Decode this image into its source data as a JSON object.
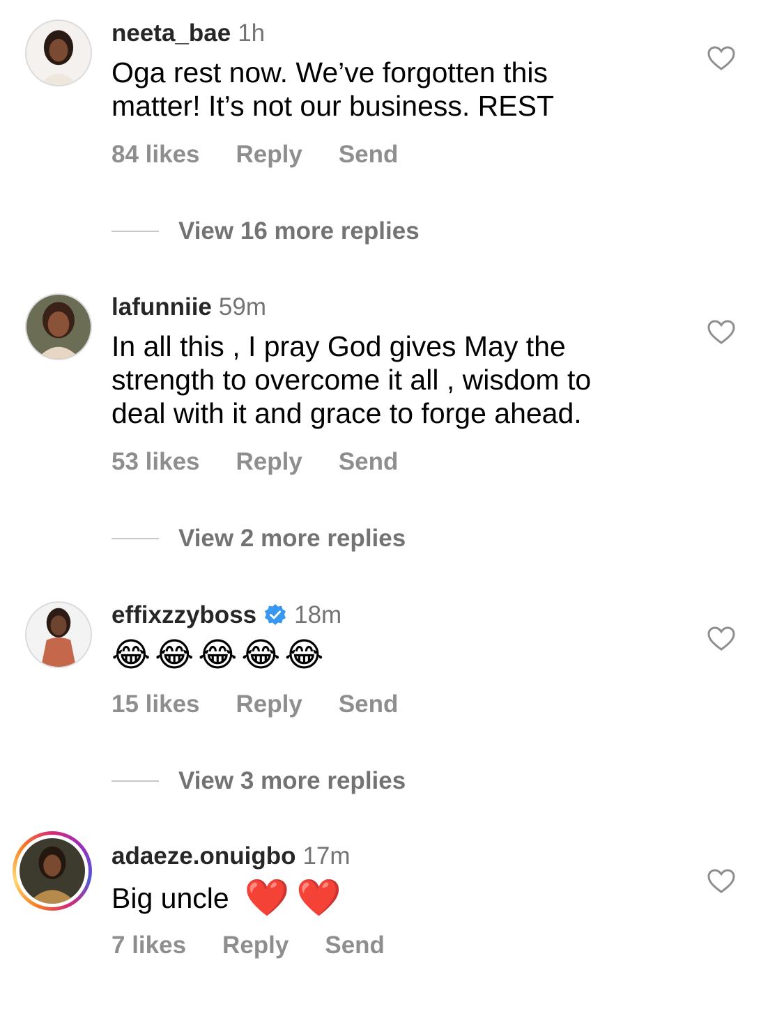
{
  "comments": [
    {
      "username": "neeta_bae",
      "time": "1h",
      "text_lines": [
        "Oga rest now. We’ve forgotten this",
        "matter! It’s not our business. REST"
      ],
      "likes": "84 likes",
      "reply": "Reply",
      "send": "Send",
      "view_replies": "View 16 more replies"
    },
    {
      "username": "lafunniie",
      "time": "59m",
      "text_lines": [
        "In all this , I pray God gives May the",
        "strength to overcome it all , wisdom to",
        "deal with it  and grace to forge ahead."
      ],
      "likes": "53 likes",
      "reply": "Reply",
      "send": "Send",
      "view_replies": "View 2 more replies"
    },
    {
      "username": "effixzzyboss",
      "time": "18m",
      "verified": true,
      "emojis": [
        "😂",
        "😂",
        "😂",
        "😂",
        "😂"
      ],
      "likes": "15 likes",
      "reply": "Reply",
      "send": "Send",
      "view_replies": "View 3 more replies"
    },
    {
      "username": "adaeze.onuigbo",
      "time": "17m",
      "text": "Big uncle",
      "emojis": [
        "❤️",
        "❤️"
      ],
      "likes": "7 likes",
      "reply": "Reply",
      "send": "Send"
    }
  ],
  "icons": {
    "like": "heart-outline-icon",
    "verified": "verified-badge-icon"
  },
  "colors": {
    "username": "#262626",
    "meta": "#737373",
    "actions": "#8e8e8e",
    "verified": "#3897f0",
    "heart": "#e0242b"
  }
}
